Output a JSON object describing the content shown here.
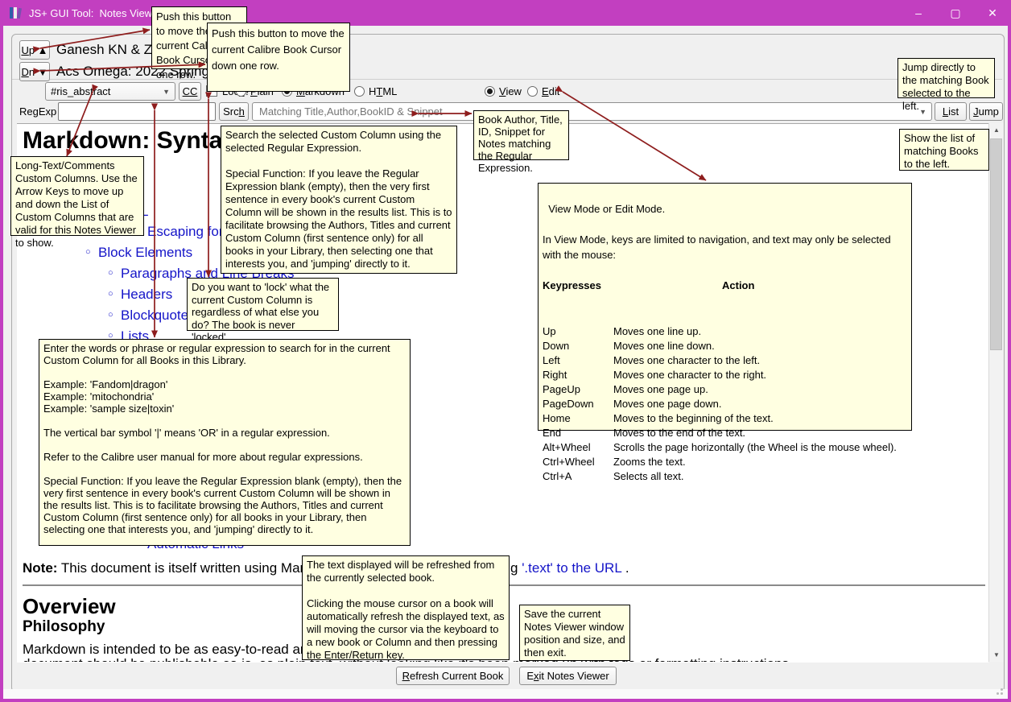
{
  "window": {
    "title": "JS+ GUI Tool:  Notes Viewer",
    "controls": {
      "minimize": "–",
      "maximize": "▢",
      "close": "✕"
    }
  },
  "toolbar": {
    "up_button": {
      "label": "Up ▲",
      "mnemonic": "U"
    },
    "dn_button": {
      "label": "Dn ▼",
      "mnemonic": "D"
    },
    "book_author": "Ganesh KN & Zha",
    "book_title": "Acs Omega: 2022 Spring Forward, 2",
    "column_select": {
      "value": "#ris_abstract"
    },
    "cc_button": {
      "label": "CC",
      "mnemonic": "CC"
    },
    "lock_checkbox": {
      "label": "Lock?",
      "mnemonic": "k",
      "checked": false
    },
    "format_radios": [
      {
        "label": "Plain",
        "mnemonic": "P",
        "selected": false
      },
      {
        "label": "Markdown",
        "mnemonic": "M",
        "selected": true
      },
      {
        "label": "HTML",
        "mnemonic": "T",
        "selected": false
      }
    ],
    "mode_radios": [
      {
        "label": "View",
        "mnemonic": "V",
        "selected": true
      },
      {
        "label": "Edit",
        "mnemonic": "E",
        "selected": false
      }
    ]
  },
  "search_row": {
    "regexp_label": "RegExp",
    "regexp_value": "",
    "srch_button": {
      "label": "Srch",
      "mnemonic": "h"
    },
    "results_placeholder": "Matching Title,Author,BookID & Snippet",
    "list_button": {
      "label": "List",
      "mnemonic": "L"
    },
    "jump_button": {
      "label": "Jump",
      "mnemonic": "J"
    }
  },
  "document": {
    "h1": "Markdown: Synta",
    "toc_bullet": "○",
    "toc": [
      "L",
      "Escaping for Sp",
      "Block Elements",
      "Paragraphs and Line Breaks",
      "Headers",
      "Blockquotes",
      "Lists",
      "Automatic Links"
    ],
    "note_label": "Note:",
    "note_text": " This document is itself written using Markdown",
    "note_right_pre": "g ",
    "note_right_link": "'.text' to the URL",
    "note_right_post": " .",
    "h2": "Overview",
    "h3": "Philosophy",
    "body_line": "Markdown is intended to be as easy-to-read and easy",
    "clipped_line": "document should be publishable as-is, as plain text, without looking like it's been marked up with tags or formatting instructions."
  },
  "callouts": {
    "up": {
      "text": "Push this button to move the current Calibre Book Cursor up one row."
    },
    "dn": {
      "text": "Push this button to move the current Calibre Book Cursor down one row."
    },
    "jump": {
      "text": "Jump directly to the matching Book selected to the left."
    },
    "list": {
      "text": "Show the list of matching Books to the left."
    },
    "book": {
      "text": "Book Author, Title, ID, Snippet for Notes matching the Regular Expression."
    },
    "search": {
      "text": "Search the selected Custom Column using the selected Regular Expression.\n\nSpecial Function: If you leave the Regular Expression blank (empty), then the very first sentence in every book's current Custom Column will be shown in the results list. This is to facilitate browsing the Authors, Titles and current Custom Column (first sentence only) for all books in your Library, then selecting one that interests you, and 'jumping' directly to it."
    },
    "longtext": {
      "text": "Long-Text/Comments Custom Columns. Use the Arrow Keys to move up and down the List of Custom Columns that are valid for this Notes Viewer to show."
    },
    "lock": {
      "text": "Do you want to 'lock' what the current Custom Column is regardless of what else you do? The book is never 'locked'."
    },
    "view_mode": {
      "intro": "View Mode or Edit Mode.\n\nIn View Mode, keys are limited to navigation, and text may only be selected with the mouse:",
      "col_key": "Keypresses",
      "col_action": "Action",
      "keys": [
        {
          "key": "Up",
          "action": "Moves one line up."
        },
        {
          "key": "Down",
          "action": "Moves one line down."
        },
        {
          "key": "Left",
          "action": "Moves one character to the left."
        },
        {
          "key": "Right",
          "action": "Moves one character to the right."
        },
        {
          "key": "PageUp",
          "action": "Moves one page up."
        },
        {
          "key": "PageDown",
          "action": "Moves one page down."
        },
        {
          "key": "Home",
          "action": "Moves to the beginning of the text."
        },
        {
          "key": "End",
          "action": "Moves to the end of the text."
        },
        {
          "key": "Alt+Wheel",
          "action": "Scrolls the page horizontally (the Wheel is the mouse wheel)."
        },
        {
          "key": "Ctrl+Wheel",
          "action": "Zooms the text."
        },
        {
          "key": "Ctrl+A",
          "action": "Selects all text."
        }
      ]
    },
    "regexp": {
      "text": "Enter the words or phrase or regular expression to search for in the current Custom Column for all Books in this Library.\n\nExample: 'Fandom|dragon'\nExample: 'mitochondria'\nExample: 'sample size|toxin'\n\nThe vertical bar symbol '|' means 'OR' in a regular expression.\n\nRefer to the Calibre user manual for more about regular expressions.\n\nSpecial Function: If you leave the Regular Expression blank (empty), then the very first sentence in every book's current Custom Column will be shown in the results list. This is to facilitate browsing the Authors, Titles and current Custom Column (first sentence only) for all books in your Library, then selecting one that interests you, and 'jumping' directly to it."
    },
    "refresh": {
      "text": "The text displayed will be refreshed from the currently selected book.\n\nClicking the mouse cursor on a book will automatically refresh the displayed text, as will moving the cursor via the keyboard to a new book or Column and then pressing the Enter/Return key."
    },
    "save": {
      "text": "Save the current Notes Viewer window position and size, and then exit."
    }
  },
  "bottom": {
    "refresh_button": {
      "label": "Refresh Current Book",
      "mnemonic": "R"
    },
    "exit_button": {
      "label": "Exit Notes Viewer",
      "mnemonic": "x"
    }
  },
  "colors": {
    "titlebar": "#c23fc0",
    "callout_bg": "#ffffe1",
    "arrow": "#8e1d1d",
    "link": "#1414c8"
  }
}
